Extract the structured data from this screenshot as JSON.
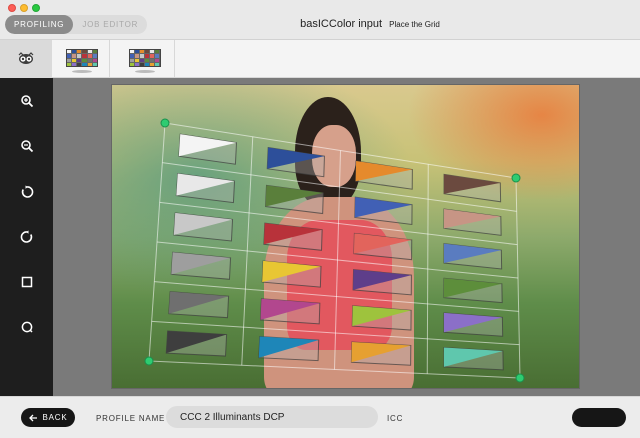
{
  "titlebar": {
    "tabs": [
      {
        "label": "PROFILING",
        "active": true
      },
      {
        "label": "JOB EDITOR",
        "active": false
      }
    ],
    "title": "basICColor input",
    "subtitle": "Place the Grid"
  },
  "toolbar": {
    "items": [
      "owl-icon",
      "color-chart-icon",
      "color-chart-icon"
    ]
  },
  "sidebar": {
    "tools": [
      "zoom-in-icon",
      "zoom-out-icon",
      "rotate-left-icon",
      "rotate-right-icon",
      "square-icon",
      "circle-icon"
    ]
  },
  "bottom": {
    "back_label": "BACK",
    "profile_name_label": "PROFILE NAME",
    "profile_name_value": "CCC 2 Illuminants DCP",
    "icc_label": "ICC"
  },
  "colors": {
    "accent": "#2ecc71",
    "sidebar_bg": "#1e1e1e",
    "button_bg": "#161616"
  },
  "patches": [
    {
      "row": 0,
      "col": 0,
      "color": "#f4f4f4"
    },
    {
      "row": 0,
      "col": 1,
      "color": "#2d4f9a"
    },
    {
      "row": 0,
      "col": 2,
      "color": "#e58a2c"
    },
    {
      "row": 0,
      "col": 3,
      "color": "#6b4a3f"
    },
    {
      "row": 1,
      "col": 0,
      "color": "#e8e8e8"
    },
    {
      "row": 1,
      "col": 1,
      "color": "#5a7f3b"
    },
    {
      "row": 1,
      "col": 2,
      "color": "#4160b5"
    },
    {
      "row": 1,
      "col": 3,
      "color": "#c79585"
    },
    {
      "row": 2,
      "col": 0,
      "color": "#c8c8c8"
    },
    {
      "row": 2,
      "col": 1,
      "color": "#b8323a"
    },
    {
      "row": 2,
      "col": 2,
      "color": "#e2645c"
    },
    {
      "row": 2,
      "col": 3,
      "color": "#5a7cc0"
    },
    {
      "row": 3,
      "col": 0,
      "color": "#9e9e9e"
    },
    {
      "row": 3,
      "col": 1,
      "color": "#e8c633"
    },
    {
      "row": 3,
      "col": 2,
      "color": "#5e3e8a"
    },
    {
      "row": 3,
      "col": 3,
      "color": "#5d8e3b"
    },
    {
      "row": 4,
      "col": 0,
      "color": "#6f6f6f"
    },
    {
      "row": 4,
      "col": 1,
      "color": "#b2478e"
    },
    {
      "row": 4,
      "col": 2,
      "color": "#9ec33d"
    },
    {
      "row": 4,
      "col": 3,
      "color": "#8b6fc8"
    },
    {
      "row": 5,
      "col": 0,
      "color": "#3e3e3e"
    },
    {
      "row": 5,
      "col": 1,
      "color": "#1e86b8"
    },
    {
      "row": 5,
      "col": 2,
      "color": "#e6a031"
    },
    {
      "row": 5,
      "col": 3,
      "color": "#5fc7ad"
    }
  ]
}
